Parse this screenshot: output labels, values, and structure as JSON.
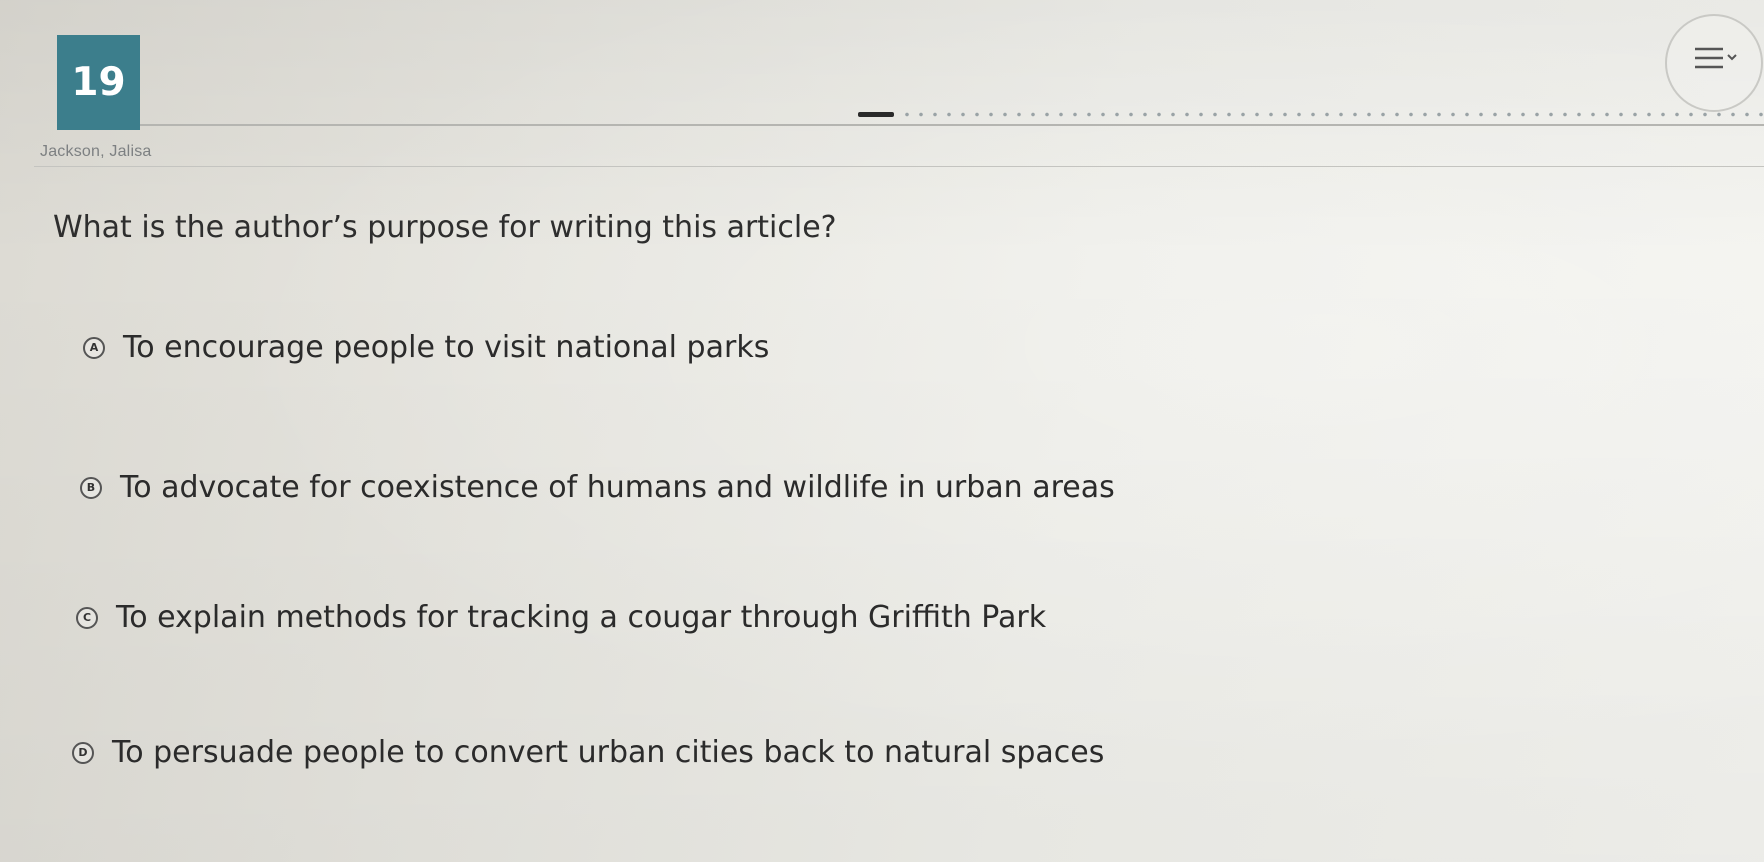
{
  "question_number": "19",
  "student_name": "Jackson, Jalisa",
  "question_text": "What is the author’s purpose for writing this article?",
  "choices": [
    {
      "letter": "A",
      "text": "To encourage people to visit national parks"
    },
    {
      "letter": "B",
      "text": "To advocate for coexistence of humans and wildlife in urban areas"
    },
    {
      "letter": "C",
      "text": "To explain methods for tracking a cougar through Griffith Park"
    },
    {
      "letter": "D",
      "text": "To persuade people to convert urban cities back to natural spaces"
    }
  ],
  "icons": {
    "menu": "menu-icon"
  },
  "colors": {
    "question_number_bg": "#3c7e8c",
    "question_number_text": "#ffffff"
  }
}
